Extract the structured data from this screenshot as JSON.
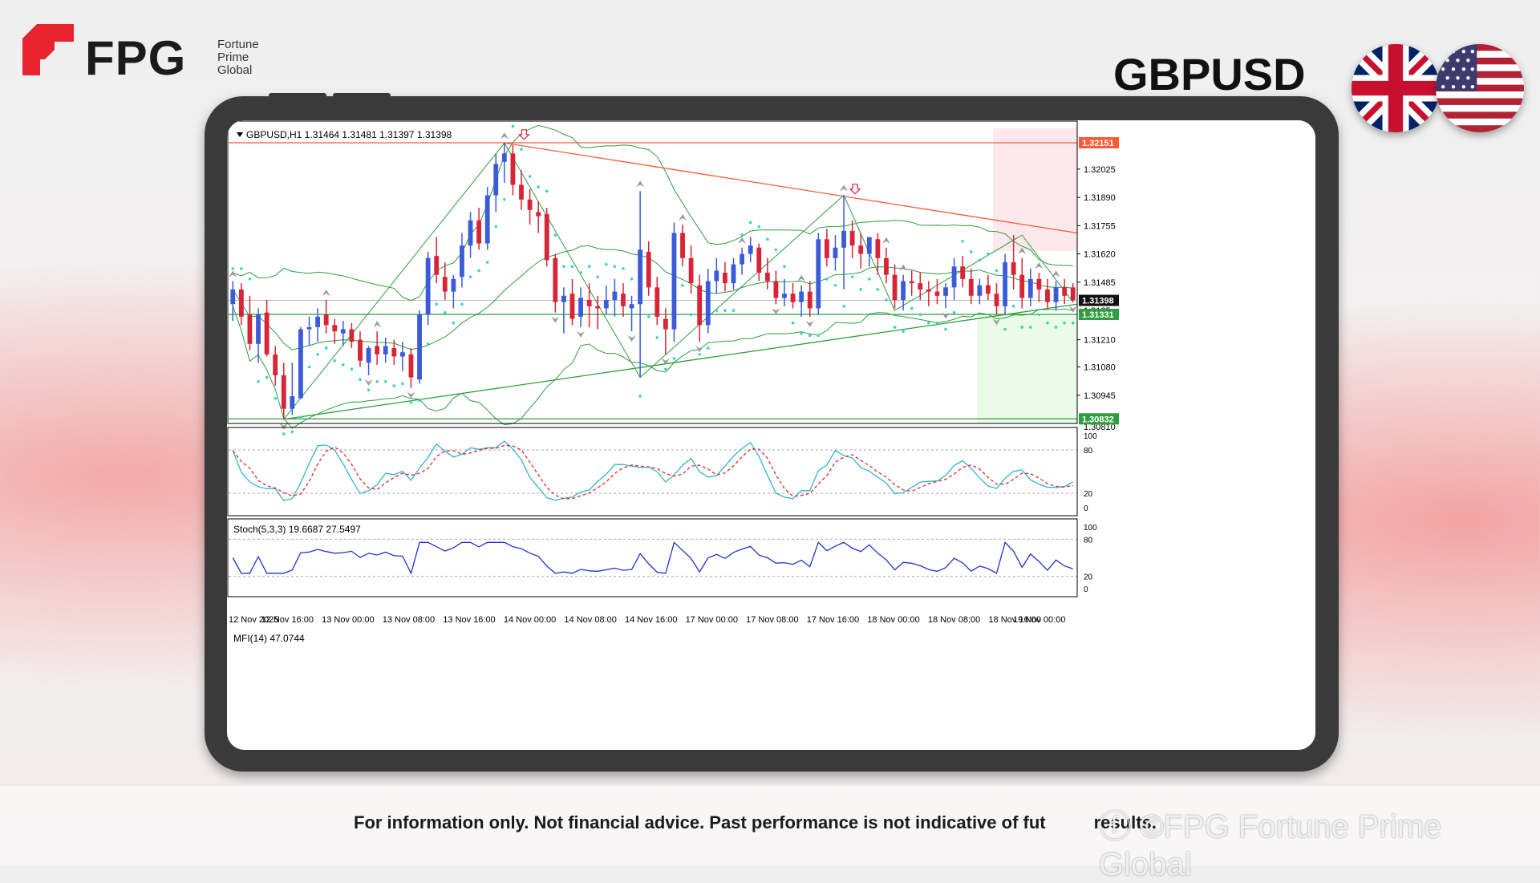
{
  "brand": {
    "name": "FPG",
    "subtitle_lines": [
      "Fortune",
      "Prime",
      "Global"
    ]
  },
  "symbol": "GBPUSD",
  "flags": {
    "left": "uk-flag-icon",
    "right": "us-flag-icon"
  },
  "colors": {
    "brand_red": "#e8242f",
    "bull": "#3b5bd8",
    "bear": "#d82437",
    "band": "#2e9e3e",
    "resistance": "#ff5a36",
    "psar": "#3fd1c8",
    "stoch_main": "#32b6c8",
    "stoch_signal": "#e02a2a",
    "mfi": "#2233cc"
  },
  "chart": {
    "header": "GBPUSD,H1  1.31464 1.31481 1.31397 1.31398",
    "price_labels": {
      "top": "1.32151",
      "current": "1.31398",
      "support": "1.31331",
      "bottom": "1.30832",
      "hidden": "1.3135",
      "cut": "1.30810"
    },
    "time_labels": [
      "12 Nov 2025",
      "12 Nov 16:00",
      "13 Nov 00:00",
      "13 Nov 08:00",
      "13 Nov 16:00",
      "14 Nov 00:00",
      "14 Nov 08:00",
      "14 Nov 16:00",
      "17 Nov 00:00",
      "17 Nov 08:00",
      "17 Nov 16:00",
      "18 Nov 00:00",
      "18 Nov 08:00",
      "18 Nov 16:00",
      "19 Nov 00:00"
    ]
  },
  "stoch": {
    "label": "Stoch(5,3,3) 19.6687 27.5497",
    "levels": [
      "100",
      "80",
      "20",
      "0"
    ]
  },
  "mfi": {
    "label": "MFI(14) 47.0744",
    "levels": [
      "100",
      "80",
      "20",
      "0"
    ]
  },
  "chart_data": {
    "type": "candlestick",
    "symbol": "GBPUSD",
    "timeframe": "H1",
    "ylim": [
      1.3081,
      1.3222
    ],
    "yticks": [
      1.32025,
      1.3189,
      1.31755,
      1.3162,
      1.31485,
      1.3121,
      1.3108,
      1.30945
    ],
    "levels": {
      "resistance_top": 1.32151,
      "support": 1.31331,
      "bottom": 1.30832,
      "last": 1.31398
    },
    "candles": [
      [
        1.3138,
        1.3149,
        1.313,
        1.3145
      ],
      [
        1.3145,
        1.3148,
        1.3128,
        1.3132
      ],
      [
        1.3133,
        1.3142,
        1.3116,
        1.3119
      ],
      [
        1.3119,
        1.3136,
        1.311,
        1.3133
      ],
      [
        1.3134,
        1.314,
        1.3113,
        1.3114
      ],
      [
        1.3114,
        1.3118,
        1.3099,
        1.3104
      ],
      [
        1.3104,
        1.311,
        1.3083,
        1.3088
      ],
      [
        1.3088,
        1.311,
        1.3085,
        1.3094
      ],
      [
        1.3093,
        1.3127,
        1.3093,
        1.3126
      ],
      [
        1.3126,
        1.3132,
        1.3118,
        1.3127
      ],
      [
        1.3127,
        1.3136,
        1.312,
        1.3132
      ],
      [
        1.3133,
        1.314,
        1.3124,
        1.3128
      ],
      [
        1.3128,
        1.3131,
        1.3119,
        1.3125
      ],
      [
        1.3124,
        1.313,
        1.3118,
        1.3126
      ],
      [
        1.3126,
        1.3129,
        1.3117,
        1.312
      ],
      [
        1.3121,
        1.3125,
        1.3108,
        1.3111
      ],
      [
        1.311,
        1.3118,
        1.3104,
        1.3117
      ],
      [
        1.3118,
        1.3125,
        1.3109,
        1.3114
      ],
      [
        1.3114,
        1.3122,
        1.311,
        1.3118
      ],
      [
        1.3117,
        1.3121,
        1.3109,
        1.3113
      ],
      [
        1.3113,
        1.312,
        1.3106,
        1.3115
      ],
      [
        1.3114,
        1.3117,
        1.3098,
        1.3103
      ],
      [
        1.3102,
        1.3135,
        1.31,
        1.3133
      ],
      [
        1.3133,
        1.3163,
        1.3128,
        1.316
      ],
      [
        1.3161,
        1.317,
        1.3148,
        1.3152
      ],
      [
        1.3151,
        1.3158,
        1.314,
        1.3144
      ],
      [
        1.3144,
        1.3152,
        1.3136,
        1.315
      ],
      [
        1.3151,
        1.3172,
        1.3146,
        1.3166
      ],
      [
        1.3166,
        1.3182,
        1.316,
        1.3178
      ],
      [
        1.3178,
        1.3184,
        1.3164,
        1.3167
      ],
      [
        1.3167,
        1.3194,
        1.3164,
        1.319
      ],
      [
        1.319,
        1.321,
        1.3182,
        1.3205
      ],
      [
        1.3206,
        1.3215,
        1.3196,
        1.321
      ],
      [
        1.321,
        1.3214,
        1.319,
        1.3195
      ],
      [
        1.3195,
        1.3202,
        1.3183,
        1.3188
      ],
      [
        1.3188,
        1.3193,
        1.3176,
        1.3183
      ],
      [
        1.3182,
        1.3187,
        1.3172,
        1.318
      ],
      [
        1.3181,
        1.3184,
        1.3156,
        1.3159
      ],
      [
        1.316,
        1.3162,
        1.3134,
        1.3139
      ],
      [
        1.3139,
        1.3146,
        1.3124,
        1.3142
      ],
      [
        1.3143,
        1.315,
        1.3128,
        1.3131
      ],
      [
        1.3132,
        1.3146,
        1.3127,
        1.3141
      ],
      [
        1.314,
        1.3148,
        1.3127,
        1.3137
      ],
      [
        1.3137,
        1.3142,
        1.3126,
        1.3136
      ],
      [
        1.3136,
        1.3147,
        1.3133,
        1.314
      ],
      [
        1.314,
        1.315,
        1.3132,
        1.3144
      ],
      [
        1.3143,
        1.3148,
        1.3132,
        1.3137
      ],
      [
        1.3136,
        1.3142,
        1.3125,
        1.3138
      ],
      [
        1.3138,
        1.3192,
        1.3103,
        1.3164
      ],
      [
        1.3163,
        1.3168,
        1.3142,
        1.3146
      ],
      [
        1.3146,
        1.3151,
        1.3128,
        1.3132
      ],
      [
        1.3131,
        1.3136,
        1.3114,
        1.3126
      ],
      [
        1.3126,
        1.3177,
        1.312,
        1.3172
      ],
      [
        1.3172,
        1.3176,
        1.3156,
        1.316
      ],
      [
        1.316,
        1.3166,
        1.3143,
        1.3148
      ],
      [
        1.3147,
        1.3152,
        1.312,
        1.3128
      ],
      [
        1.3128,
        1.3155,
        1.3124,
        1.3149
      ],
      [
        1.3149,
        1.316,
        1.3143,
        1.3154
      ],
      [
        1.3153,
        1.3158,
        1.3144,
        1.3148
      ],
      [
        1.3148,
        1.316,
        1.3145,
        1.3157
      ],
      [
        1.3157,
        1.3165,
        1.3152,
        1.3162
      ],
      [
        1.3162,
        1.317,
        1.3158,
        1.3166
      ],
      [
        1.3165,
        1.3167,
        1.3149,
        1.3153
      ],
      [
        1.3153,
        1.316,
        1.3145,
        1.3149
      ],
      [
        1.3149,
        1.3154,
        1.3138,
        1.3141
      ],
      [
        1.3141,
        1.315,
        1.3137,
        1.3143
      ],
      [
        1.3143,
        1.3148,
        1.3136,
        1.3139
      ],
      [
        1.3139,
        1.3147,
        1.3132,
        1.3144
      ],
      [
        1.3144,
        1.3149,
        1.3132,
        1.3136
      ],
      [
        1.3136,
        1.3172,
        1.3133,
        1.3169
      ],
      [
        1.3169,
        1.3174,
        1.3156,
        1.316
      ],
      [
        1.316,
        1.3171,
        1.3154,
        1.3165
      ],
      [
        1.3165,
        1.319,
        1.3145,
        1.3173
      ],
      [
        1.3173,
        1.3178,
        1.316,
        1.3166
      ],
      [
        1.3166,
        1.3172,
        1.3155,
        1.3162
      ],
      [
        1.3162,
        1.317,
        1.3156,
        1.317
      ],
      [
        1.3169,
        1.3172,
        1.3152,
        1.316
      ],
      [
        1.316,
        1.3165,
        1.3148,
        1.3152
      ],
      [
        1.3152,
        1.3157,
        1.3136,
        1.314
      ],
      [
        1.314,
        1.3152,
        1.3135,
        1.3149
      ],
      [
        1.3149,
        1.3154,
        1.3142,
        1.3148
      ],
      [
        1.3148,
        1.3153,
        1.314,
        1.3145
      ],
      [
        1.3145,
        1.3149,
        1.3137,
        1.3144
      ],
      [
        1.3144,
        1.315,
        1.3138,
        1.3142
      ],
      [
        1.3142,
        1.3148,
        1.3136,
        1.3146
      ],
      [
        1.3146,
        1.316,
        1.314,
        1.3156
      ],
      [
        1.3156,
        1.3161,
        1.3146,
        1.315
      ],
      [
        1.315,
        1.3155,
        1.3138,
        1.3142
      ],
      [
        1.3142,
        1.315,
        1.3138,
        1.3147
      ],
      [
        1.3147,
        1.3152,
        1.314,
        1.3143
      ],
      [
        1.3143,
        1.3148,
        1.3133,
        1.3137
      ],
      [
        1.3137,
        1.3162,
        1.3133,
        1.3158
      ],
      [
        1.3158,
        1.3171,
        1.3145,
        1.3152
      ],
      [
        1.3152,
        1.316,
        1.3136,
        1.3141
      ],
      [
        1.3141,
        1.3155,
        1.3137,
        1.315
      ],
      [
        1.315,
        1.3153,
        1.3139,
        1.3145
      ],
      [
        1.3145,
        1.315,
        1.3136,
        1.3139
      ],
      [
        1.3139,
        1.3149,
        1.3135,
        1.3146
      ],
      [
        1.3146,
        1.315,
        1.3138,
        1.3142
      ],
      [
        1.3146,
        1.3148,
        1.3139,
        1.314
      ]
    ]
  }
}
